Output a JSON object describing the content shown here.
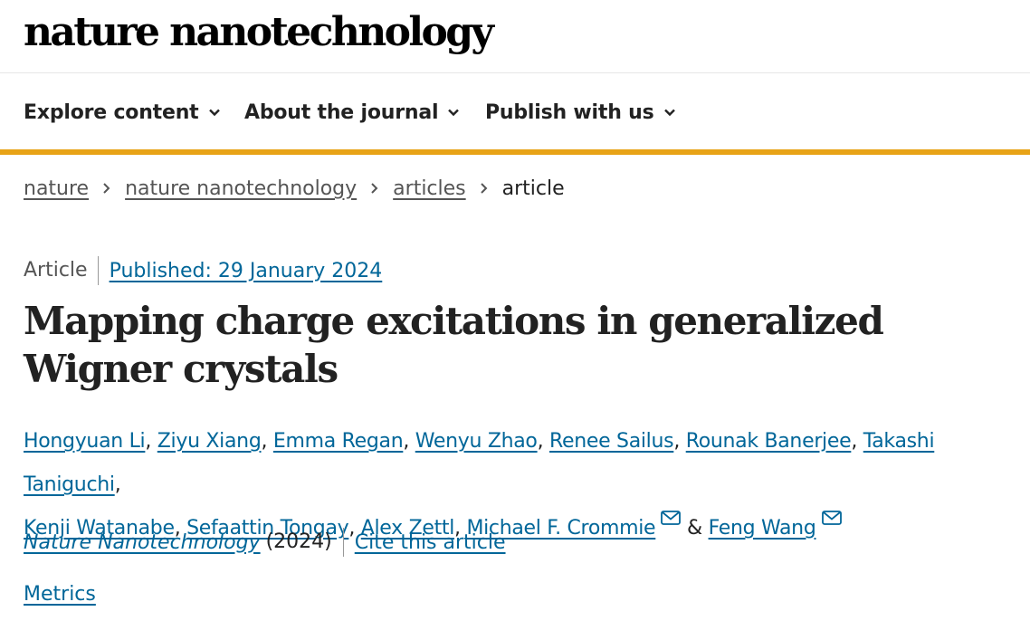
{
  "header": {
    "logo_text": "nature nanotechnology"
  },
  "nav": {
    "items": [
      {
        "label": "Explore content"
      },
      {
        "label": "About the journal"
      },
      {
        "label": "Publish with us"
      }
    ]
  },
  "breadcrumb": {
    "items": [
      "nature",
      "nature nanotechnology",
      "articles"
    ],
    "current": "article"
  },
  "article": {
    "type": "Article",
    "published": "Published: 29 January 2024",
    "title": "Mapping charge excitations in generalized Wigner crystals",
    "authors": [
      "Hongyuan Li",
      "Ziyu Xiang",
      "Emma Regan",
      "Wenyu Zhao",
      "Renee Sailus",
      "Rounak Banerjee",
      "Takashi Taniguchi",
      "Kenji Watanabe",
      "Sefaattin Tongay",
      "Alex Zettl",
      "Michael F. Crommie",
      "Feng Wang"
    ],
    "ampersand": "&",
    "journal": "Nature Nanotechnology",
    "year": "(2024)",
    "cite": "Cite this article",
    "metrics": "Metrics"
  },
  "colors": {
    "accent": "#e8a317",
    "link": "#006699",
    "text": "#222222"
  },
  "icons": {
    "nav_chevron": "chevron-down-icon",
    "breadcrumb_sep": "chevron-right-icon",
    "corresponding": "mail-icon"
  }
}
